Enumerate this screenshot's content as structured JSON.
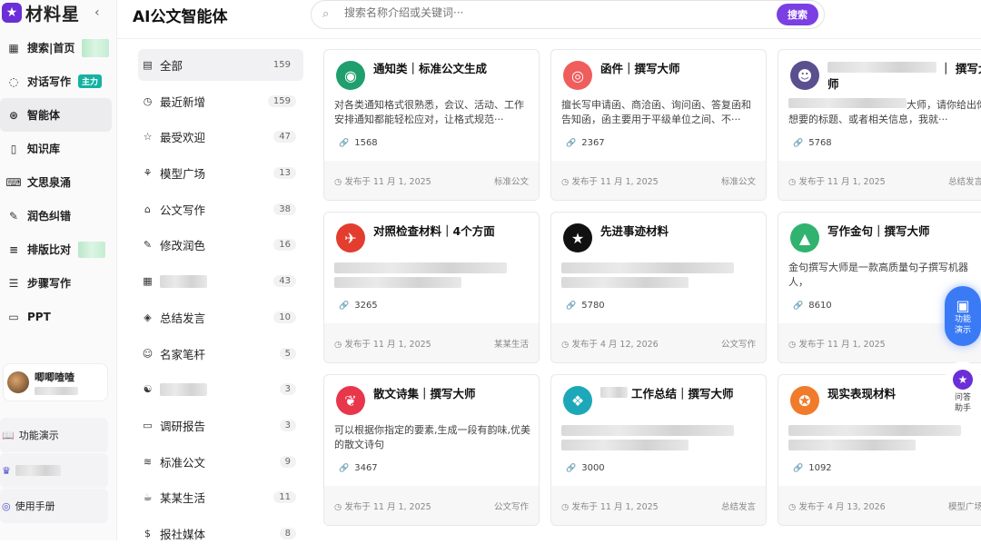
{
  "sidebar": {
    "brand": "材料星",
    "items": [
      {
        "icon": "grid-icon",
        "label": "搜索|首页"
      },
      {
        "icon": "chat-icon",
        "label": "对话写作",
        "badge": "主力"
      },
      {
        "icon": "brain-icon",
        "label": "智能体"
      },
      {
        "icon": "book-icon",
        "label": "知识库"
      },
      {
        "icon": "keyboard-icon",
        "label": "文思泉涌"
      },
      {
        "icon": "pen-icon",
        "label": "润色纠错"
      },
      {
        "icon": "menu-icon",
        "label": "排版比对"
      },
      {
        "icon": "list-icon",
        "label": "步骤写作"
      },
      {
        "icon": "presentation-icon",
        "label": "PPT"
      }
    ],
    "user": {
      "name": "唧唧喳喳"
    },
    "bottom": [
      {
        "icon": "book-open-icon",
        "label": "功能演示"
      },
      {
        "icon": "crown-icon",
        "label": ""
      },
      {
        "icon": "compass-icon",
        "label": "使用手册"
      }
    ]
  },
  "header": {
    "title": "AI公文智能体",
    "search_placeholder": "搜索名称介绍或关键词···",
    "search_button": "搜索"
  },
  "categories": [
    {
      "icon": "▤",
      "label": "全部",
      "count": "159"
    },
    {
      "icon": "◷",
      "label": "最近新增",
      "count": "159"
    },
    {
      "icon": "☆",
      "label": "最受欢迎",
      "count": "47"
    },
    {
      "icon": "⚘",
      "label": "模型广场",
      "count": "13"
    },
    {
      "icon": "⌂",
      "label": "公文写作",
      "count": "38"
    },
    {
      "icon": "✎",
      "label": "修改润色",
      "count": "16"
    },
    {
      "icon": "▦",
      "label": "",
      "count": "43"
    },
    {
      "icon": "◈",
      "label": "总结发言",
      "count": "10"
    },
    {
      "icon": "☺",
      "label": "名家笔杆",
      "count": "5"
    },
    {
      "icon": "☯",
      "label": "",
      "count": "3"
    },
    {
      "icon": "▭",
      "label": "调研报告",
      "count": "3"
    },
    {
      "icon": "≋",
      "label": "标准公文",
      "count": "9"
    },
    {
      "icon": "☕",
      "label": "某某生活",
      "count": "11"
    },
    {
      "icon": "$",
      "label": "报社媒体",
      "count": "8"
    }
  ],
  "cards": [
    {
      "title": "通知类｜标准公文生成",
      "desc": "对各类通知格式很熟悉，会议、活动、工作安排通知都能轻松应对，让格式规范···",
      "uses": "1568",
      "date": "发布于 11 月 1, 2025",
      "category": "标准公文",
      "color": "#1f9e6e",
      "glyph": "◉"
    },
    {
      "title": "函件｜撰写大师",
      "desc": "擅长写申请函、商洽函、询问函、答复函和告知函，函主要用于平级单位之间、不···",
      "uses": "2367",
      "date": "发布于 11 月 1, 2025",
      "category": "标准公文",
      "color": "#ef5d5d",
      "glyph": "◎"
    },
    {
      "title": "｜ 撰写大师",
      "desc": "大师，请你给出你想要的标题、或者相关信息，我就···",
      "uses": "5768",
      "date": "发布于 11 月 1, 2025",
      "category": "总结发言",
      "color": "#5a4f8f",
      "glyph": "☻"
    },
    {
      "title": "对照检查材料｜4个方面",
      "desc": "",
      "uses": "3265",
      "date": "发布于 11 月 1, 2025",
      "category": "某某生活",
      "color": "#e23d2e",
      "glyph": "✈"
    },
    {
      "title": "先进事迹材料",
      "desc": "",
      "uses": "5780",
      "date": "发布于 4 月 12, 2026",
      "category": "公文写作",
      "color": "#111111",
      "glyph": "★"
    },
    {
      "title": "写作金句｜撰写大师",
      "desc": "金句撰写大师是一款高质量句子撰写机器人，",
      "uses": "8610",
      "date": "发布于 11 月 1, 2025",
      "category": "",
      "color": "#2fb36f",
      "glyph": "▲"
    },
    {
      "title": "散文诗集｜撰写大师",
      "desc": "可以根据你指定的要素,生成一段有韵味,优美的散文诗句",
      "uses": "3467",
      "date": "发布于 11 月 1, 2025",
      "category": "公文写作",
      "color": "#e8364a",
      "glyph": "❦"
    },
    {
      "title": "工作总结｜撰写大师",
      "desc": "",
      "uses": "3000",
      "date": "发布于 11 月 1, 2025",
      "category": "总结发言",
      "color": "#1ca8b8",
      "glyph": "❖"
    },
    {
      "title": "现实表现材料",
      "desc": "",
      "uses": "1092",
      "date": "发布于 4 月 13, 2026",
      "category": "模型广场",
      "color": "#f07b2a",
      "glyph": "✪"
    }
  ],
  "float": [
    {
      "label": "功能演示"
    },
    {
      "label": "问答助手"
    }
  ]
}
